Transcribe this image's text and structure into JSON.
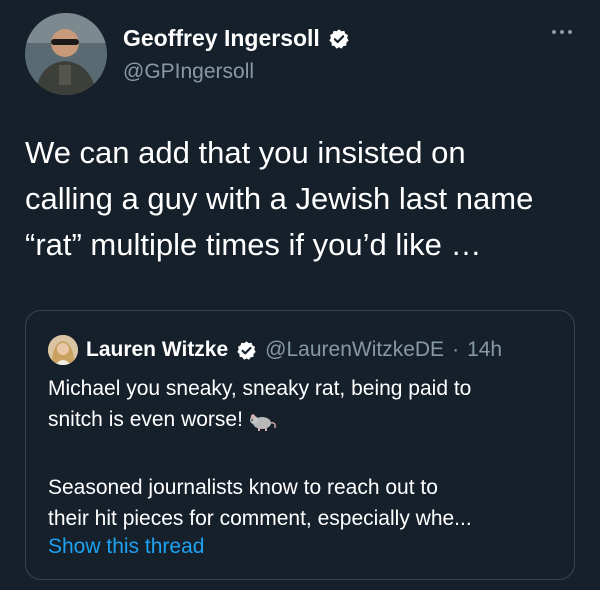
{
  "author": {
    "display_name": "Geoffrey Ingersoll",
    "handle": "@GPIngersoll",
    "verified_icon": "verified-badge-icon",
    "avatar": "author-avatar"
  },
  "more_icon": "more-options-icon",
  "tweet": {
    "lines": [
      "We can add that you insisted on",
      "calling a guy with a Jewish last name",
      "“rat” multiple times if you’d like …"
    ]
  },
  "quote": {
    "display_name": "Lauren Witzke",
    "handle": "@LaurenWitzkeDE",
    "separator": "·",
    "time": "14h",
    "line1": "Michael you sneaky, sneaky rat, being paid to",
    "line2": "snitch is even worse!",
    "line3": "Seasoned journalists know to reach out to",
    "line4": "their hit pieces for comment, especially whe...",
    "show_thread": "Show this thread",
    "emoji_icon": "rat-emoji-icon"
  },
  "colors": {
    "background": "#15202b",
    "text": "#ffffff",
    "secondary": "#8899a6",
    "link": "#1da1f2",
    "verified": "#ffffff",
    "border": "#38444d"
  }
}
